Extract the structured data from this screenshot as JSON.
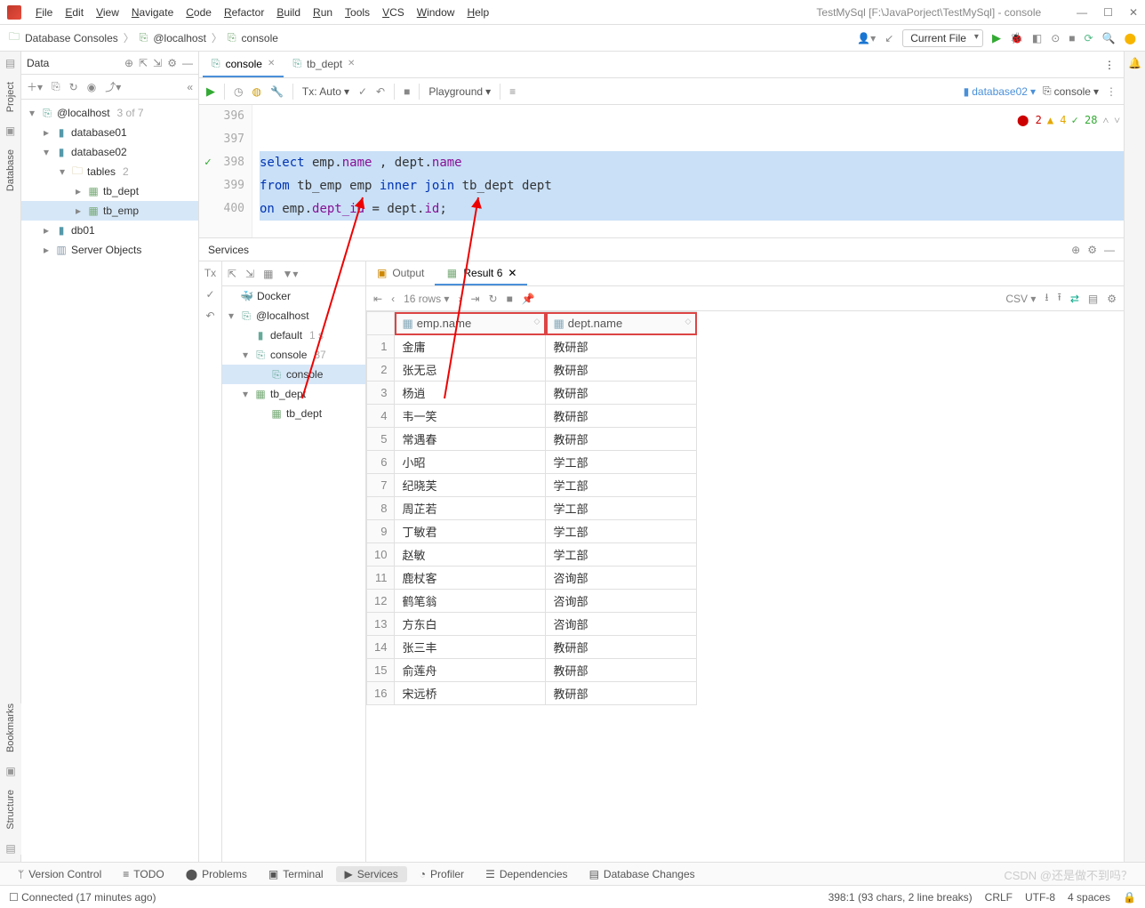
{
  "window": {
    "title": "TestMySql [F:\\JavaPorject\\TestMySql] - console"
  },
  "menu": [
    "File",
    "Edit",
    "View",
    "Navigate",
    "Code",
    "Refactor",
    "Build",
    "Run",
    "Tools",
    "VCS",
    "Window",
    "Help"
  ],
  "breadcrumb": [
    "Database Consoles",
    "@localhost",
    "console"
  ],
  "run_config": "Current File",
  "left_panel": {
    "title": "Data",
    "tree": {
      "host": "@localhost",
      "host_badge": "3 of 7",
      "db1": "database01",
      "db2": "database02",
      "tables_label": "tables",
      "tables_count": "2",
      "tb_dept": "tb_dept",
      "tb_emp": "tb_emp",
      "db01": "db01",
      "server_objects": "Server Objects"
    }
  },
  "editor_tabs": [
    {
      "label": "console",
      "active": true
    },
    {
      "label": "tb_dept",
      "active": false
    }
  ],
  "editor_toolbar": {
    "tx": "Tx: Auto",
    "playground": "Playground",
    "right_db": "database02",
    "right_console": "console"
  },
  "editor": {
    "lines": [
      {
        "n": "396",
        "plain": " "
      },
      {
        "n": "397",
        "plain": " "
      },
      {
        "n": "398",
        "hl": true,
        "html": "<span class='kw'>select</span> emp.<span class='col'>name</span> , dept.<span class='col'>name</span>",
        "check": true
      },
      {
        "n": "399",
        "hl": true,
        "html": "<span class='kw'>from</span> tb_emp emp <span class='kw'>inner join</span> tb_dept dept"
      },
      {
        "n": "400",
        "hl": true,
        "html": "<span class='kw'>on</span> emp.<span class='col'>dept_id</span> = dept.<span class='col'>id</span>;"
      }
    ],
    "status": {
      "errors": "2",
      "warnings": "4",
      "checks": "28"
    }
  },
  "services": {
    "title": "Services",
    "tree": {
      "docker": "Docker",
      "host": "@localhost",
      "default": "default",
      "default_badge": "1 s",
      "console": "console",
      "console_badge": "37",
      "console_child": "console",
      "tb_dept": "tb_dept",
      "tb_dept_child": "tb_dept"
    },
    "tabs": {
      "output": "Output",
      "result": "Result 6"
    },
    "toolbar": {
      "rows": "16 rows",
      "csv": "CSV"
    },
    "columns": [
      "emp.name",
      "dept.name"
    ],
    "rows": [
      [
        "金庸",
        "教研部"
      ],
      [
        "张无忌",
        "教研部"
      ],
      [
        "杨逍",
        "教研部"
      ],
      [
        "韦一笑",
        "教研部"
      ],
      [
        "常遇春",
        "教研部"
      ],
      [
        "小昭",
        "学工部"
      ],
      [
        "纪晓芙",
        "学工部"
      ],
      [
        "周芷若",
        "学工部"
      ],
      [
        "丁敏君",
        "学工部"
      ],
      [
        "赵敏",
        "学工部"
      ],
      [
        "鹿杖客",
        "咨询部"
      ],
      [
        "鹤笔翁",
        "咨询部"
      ],
      [
        "方东白",
        "咨询部"
      ],
      [
        "张三丰",
        "教研部"
      ],
      [
        "俞莲舟",
        "教研部"
      ],
      [
        "宋远桥",
        "教研部"
      ]
    ]
  },
  "bottom_tabs": [
    "Version Control",
    "TODO",
    "Problems",
    "Terminal",
    "Services",
    "Profiler",
    "Dependencies",
    "Database Changes"
  ],
  "bottom_active": "Services",
  "statusbar": {
    "left": "Connected (17 minutes ago)",
    "pos": "398:1 (93 chars, 2 line breaks)",
    "crlf": "CRLF",
    "enc": "UTF-8",
    "indent": "4 spaces"
  },
  "rails": {
    "project": "Project",
    "database": "Database",
    "bookmarks": "Bookmarks",
    "structure": "Structure"
  },
  "watermark": "CSDN @还是做不到吗？"
}
